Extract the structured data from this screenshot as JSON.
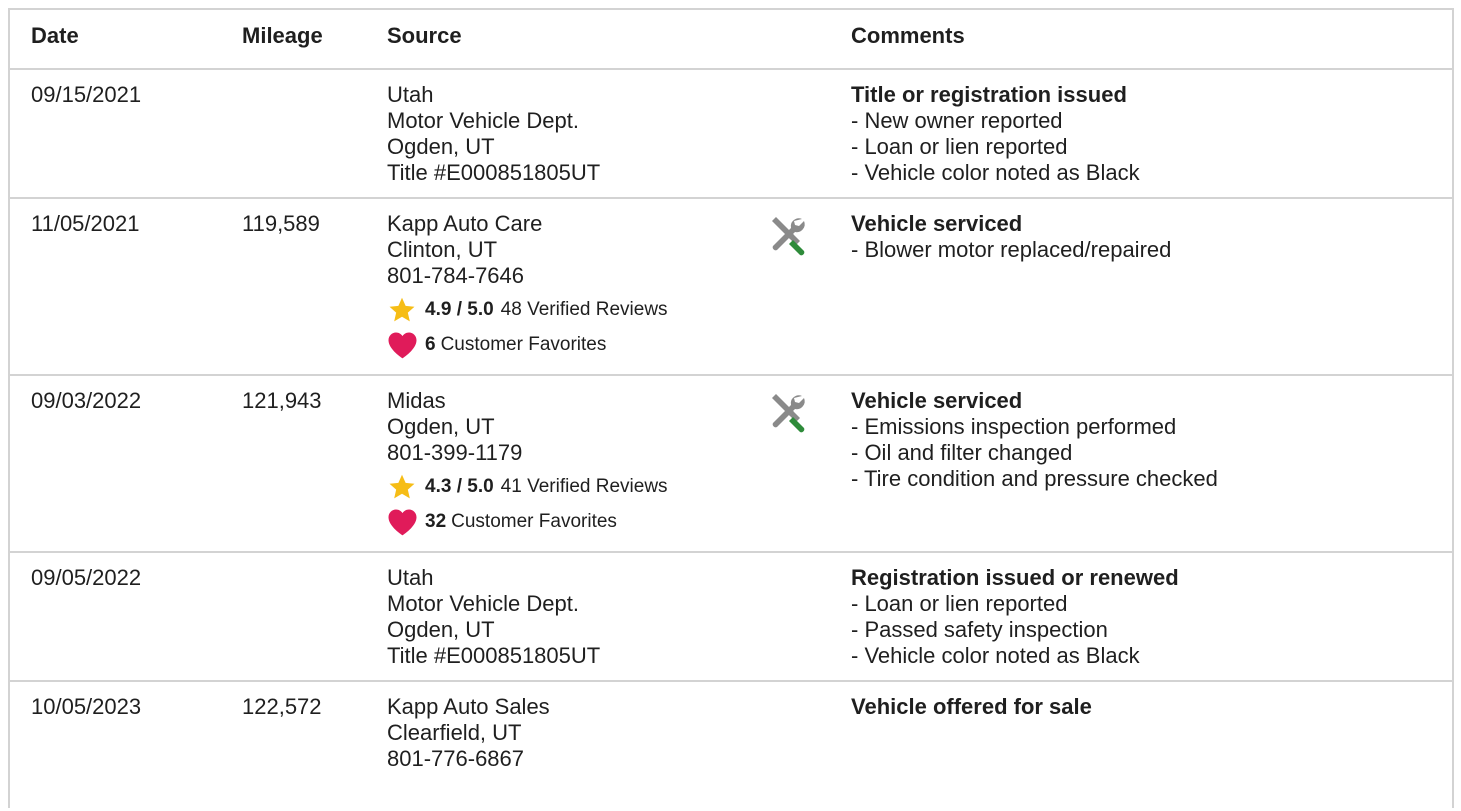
{
  "headers": {
    "date": "Date",
    "mileage": "Mileage",
    "source": "Source",
    "comments": "Comments"
  },
  "colors": {
    "star": "#f6bd16",
    "heart": "#e01b5a",
    "wrench_gray": "#8a8a8a",
    "screwdriver_green": "#2e8b3a",
    "border": "#d3d3d3"
  },
  "rows": [
    {
      "date": "09/15/2021",
      "mileage": "",
      "source": [
        "Utah",
        "Motor Vehicle Dept.",
        "Ogden, UT",
        "Title #E000851805UT"
      ],
      "comment_title": "Title or registration issued",
      "comment_items": [
        "- New owner reported",
        "- Loan or lien reported",
        "- Vehicle color noted as Black"
      ]
    },
    {
      "date": "11/05/2021",
      "mileage": "119,589",
      "source": [
        "Kapp Auto Care",
        "Clinton, UT",
        "801-784-7646"
      ],
      "rating": "4.9 / 5.0",
      "reviews": "48 Verified Reviews",
      "favorites_count": "6",
      "favorites_label": "Customer Favorites",
      "icon": "service-wrench-icon",
      "comment_title": "Vehicle serviced",
      "comment_items": [
        "- Blower motor replaced/repaired"
      ]
    },
    {
      "date": "09/03/2022",
      "mileage": "121,943",
      "source": [
        "Midas",
        "Ogden, UT",
        "801-399-1179"
      ],
      "rating": "4.3 / 5.0",
      "reviews": "41 Verified Reviews",
      "favorites_count": "32",
      "favorites_label": "Customer Favorites",
      "icon": "service-wrench-icon",
      "comment_title": "Vehicle serviced",
      "comment_items": [
        "- Emissions inspection performed",
        "- Oil and filter changed",
        "- Tire condition and pressure checked"
      ]
    },
    {
      "date": "09/05/2022",
      "mileage": "",
      "source": [
        "Utah",
        "Motor Vehicle Dept.",
        "Ogden, UT",
        "Title #E000851805UT"
      ],
      "comment_title": "Registration issued or renewed",
      "comment_items": [
        "- Loan or lien reported",
        "- Passed safety inspection",
        "- Vehicle color noted as Black"
      ]
    },
    {
      "date": "10/05/2023",
      "mileage": "122,572",
      "source": [
        "Kapp Auto Sales",
        "Clearfield, UT",
        "801-776-6867"
      ],
      "comment_title": "Vehicle offered for sale",
      "comment_items": []
    }
  ]
}
